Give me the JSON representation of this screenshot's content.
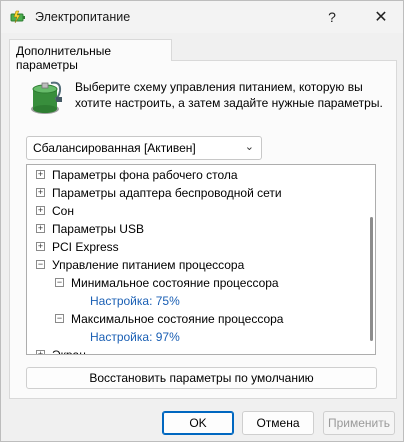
{
  "window": {
    "title": "Электропитание",
    "help_label": "?",
    "close_label": "✕"
  },
  "tab": {
    "label": "Дополнительные параметры"
  },
  "description": "Выберите схему управления питанием, которую вы хотите настроить, а затем задайте нужные параметры.",
  "scheme": {
    "selected": "Сбалансированная [Активен]"
  },
  "tree": {
    "items": [
      {
        "label": "Параметры фона рабочего стола",
        "expander": "+"
      },
      {
        "label": "Параметры адаптера беспроводной сети",
        "expander": "+"
      },
      {
        "label": "Сон",
        "expander": "+"
      },
      {
        "label": "Параметры USB",
        "expander": "+"
      },
      {
        "label": "PCI Express",
        "expander": "+"
      },
      {
        "label": "Управление питанием процессора",
        "expander": "−"
      },
      {
        "label": "Минимальное состояние процессора",
        "expander": "−"
      },
      {
        "label": "Настройка: 75%",
        "expander": ""
      },
      {
        "label": "Максимальное состояние процессора",
        "expander": "−"
      },
      {
        "label": "Настройка: 97%",
        "expander": ""
      },
      {
        "label": "Экран",
        "expander": "+"
      }
    ]
  },
  "buttons": {
    "restore": "Восстановить параметры по умолчанию",
    "ok": "OK",
    "cancel": "Отмена",
    "apply": "Применить"
  },
  "colors": {
    "link": "#1a5fb4",
    "accent": "#0067c0"
  }
}
